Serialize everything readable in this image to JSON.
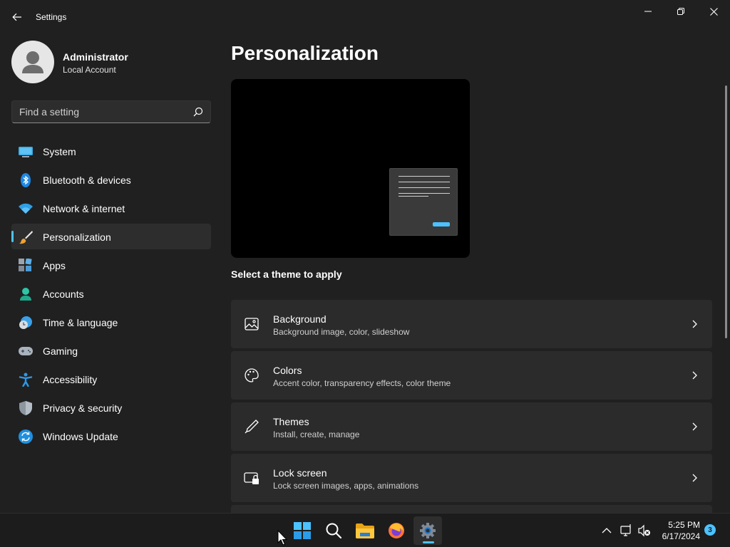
{
  "titlebar": {
    "app_title": "Settings"
  },
  "profile": {
    "name": "Administrator",
    "account_type": "Local Account"
  },
  "search": {
    "placeholder": "Find a setting"
  },
  "sidebar": {
    "items": [
      {
        "label": "System",
        "icon": "system-icon"
      },
      {
        "label": "Bluetooth & devices",
        "icon": "bluetooth-icon"
      },
      {
        "label": "Network & internet",
        "icon": "wifi-icon"
      },
      {
        "label": "Personalization",
        "icon": "brush-icon",
        "active": true
      },
      {
        "label": "Apps",
        "icon": "apps-icon"
      },
      {
        "label": "Accounts",
        "icon": "accounts-icon"
      },
      {
        "label": "Time & language",
        "icon": "time-language-icon"
      },
      {
        "label": "Gaming",
        "icon": "gamepad-icon"
      },
      {
        "label": "Accessibility",
        "icon": "accessibility-icon"
      },
      {
        "label": "Privacy & security",
        "icon": "shield-icon"
      },
      {
        "label": "Windows Update",
        "icon": "update-icon"
      }
    ]
  },
  "main": {
    "title": "Personalization",
    "theme_caption": "Select a theme to apply",
    "cards": [
      {
        "title": "Background",
        "description": "Background image, color, slideshow",
        "icon": "picture-icon"
      },
      {
        "title": "Colors",
        "description": "Accent color, transparency effects, color theme",
        "icon": "palette-icon"
      },
      {
        "title": "Themes",
        "description": "Install, create, manage",
        "icon": "pen-icon"
      },
      {
        "title": "Lock screen",
        "description": "Lock screen images, apps, animations",
        "icon": "lock-screen-icon"
      }
    ]
  },
  "taskbar": {
    "apps": [
      "start-icon",
      "search-icon",
      "file-explorer-icon",
      "firefox-icon",
      "settings-icon"
    ],
    "clock_time": "5:25 PM",
    "clock_date": "6/17/2024",
    "notification_count": "3"
  },
  "colors": {
    "accent": "#4cc2ff",
    "background": "#202020",
    "card": "#2b2b2b",
    "taskbar": "#1c1c1c"
  }
}
